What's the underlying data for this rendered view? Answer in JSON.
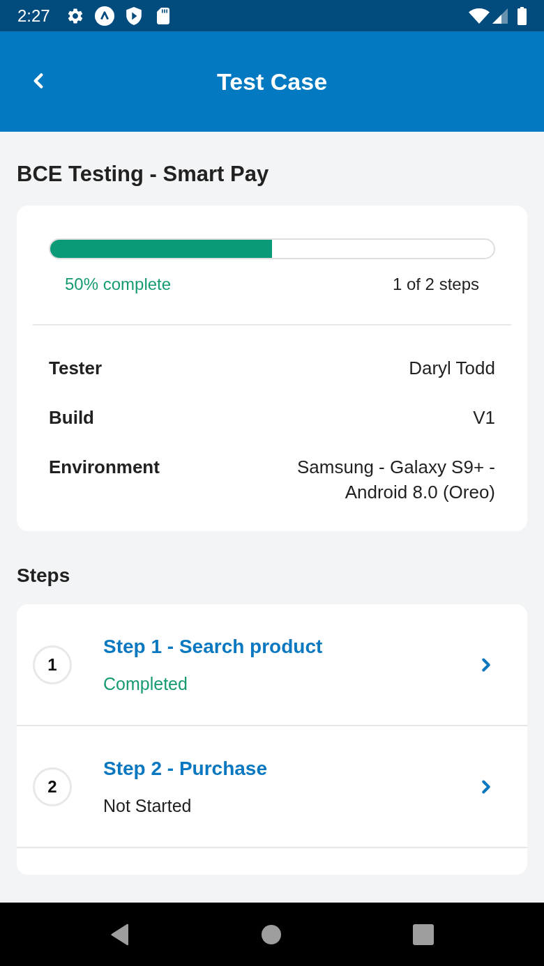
{
  "status_bar": {
    "time": "2:27"
  },
  "app_bar": {
    "title": "Test Case"
  },
  "page_title": "BCE Testing - Smart Pay",
  "progress": {
    "level": 0.5,
    "percent_label": "50% complete",
    "steps_label": "1 of 2 steps"
  },
  "details": [
    {
      "label": "Tester",
      "value": "Daryl Todd"
    },
    {
      "label": "Build",
      "value": "V1"
    },
    {
      "label": "Environment",
      "value": "Samsung - Galaxy S9+ - Android 8.0 (Oreo)"
    }
  ],
  "steps_heading": "Steps",
  "steps": [
    {
      "number": "1",
      "title": "Step 1 - Search product",
      "status": "Completed",
      "completed": true
    },
    {
      "number": "2",
      "title": "Step 2 - Purchase",
      "status": "Not Started",
      "completed": false
    }
  ]
}
